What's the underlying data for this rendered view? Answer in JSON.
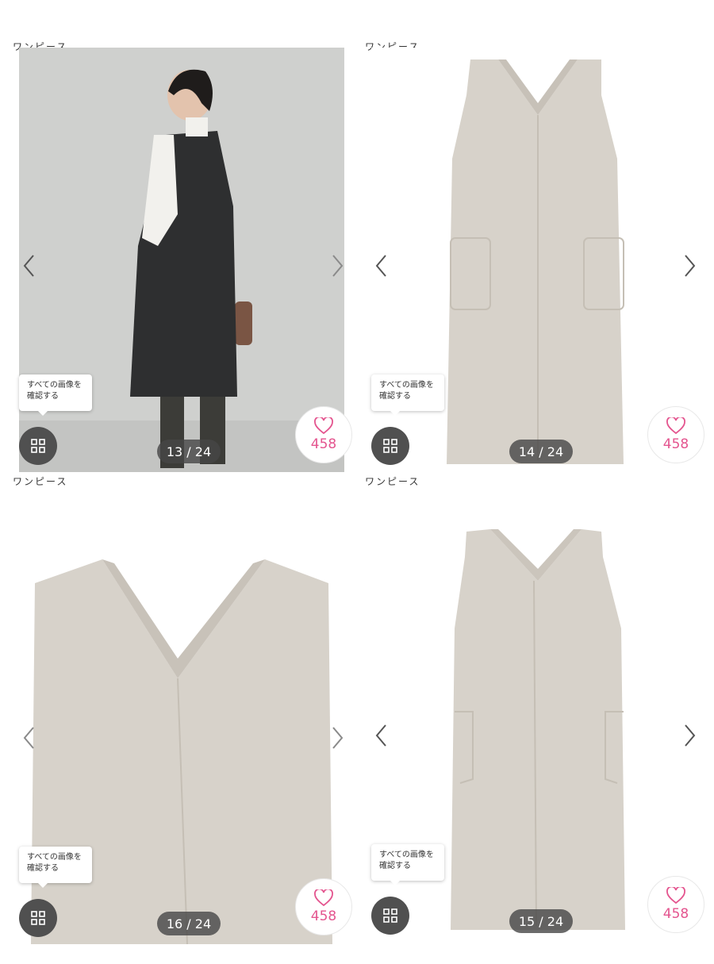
{
  "brand_color": "#e4558f",
  "panels": [
    {
      "category": "ワンピース",
      "counter": "13 / 24",
      "favorite_count": "458",
      "tooltip": [
        "すべての画像を",
        "確認する"
      ],
      "image": "model-back-view-charcoal-jumper-dress",
      "icons": {
        "prev": "chevron-left-icon",
        "next": "chevron-right-icon",
        "grid": "grid-icon",
        "favorite": "heart-icon"
      }
    },
    {
      "category": "ワンピース",
      "counter": "14 / 24",
      "favorite_count": "458",
      "tooltip": [
        "すべての画像を",
        "確認する"
      ],
      "image": "beige-jumper-dress-front",
      "icons": {
        "prev": "chevron-left-icon",
        "next": "chevron-right-icon",
        "grid": "grid-icon",
        "favorite": "heart-icon"
      }
    },
    {
      "category": "ワンピース",
      "counter": "16 / 24",
      "favorite_count": "458",
      "tooltip": [
        "すべての画像を",
        "確認する"
      ],
      "image": "beige-jumper-dress-neckline-closeup",
      "icons": {
        "prev": "chevron-left-icon",
        "next": "chevron-right-icon",
        "grid": "grid-icon",
        "favorite": "heart-icon"
      }
    },
    {
      "category": "ワンピース",
      "counter": "15 / 24",
      "favorite_count": "458",
      "tooltip": [
        "すべての画像を",
        "確認する"
      ],
      "image": "beige-jumper-dress-back",
      "icons": {
        "prev": "chevron-left-icon",
        "next": "chevron-right-icon",
        "grid": "grid-icon",
        "favorite": "heart-icon"
      }
    }
  ]
}
